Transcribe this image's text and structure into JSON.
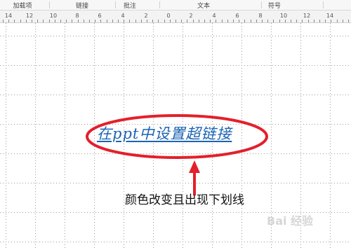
{
  "ribbon": {
    "groups": [
      "加载项",
      "链接",
      "批注",
      "文本",
      "符号"
    ]
  },
  "ruler": {
    "labels": [
      "14",
      "12",
      "10",
      "8",
      "6",
      "4",
      "2",
      "0",
      "2",
      "4",
      "6",
      "8",
      "10",
      "12",
      "14"
    ]
  },
  "slide": {
    "link_text": "在ppt中设置超链接",
    "annotation": "颜色改变且出现下划线",
    "watermark": "Bai 经验"
  },
  "colors": {
    "link": "#1b63b3",
    "highlight_ellipse": "#e3202b",
    "arrow": "#e3202b"
  }
}
